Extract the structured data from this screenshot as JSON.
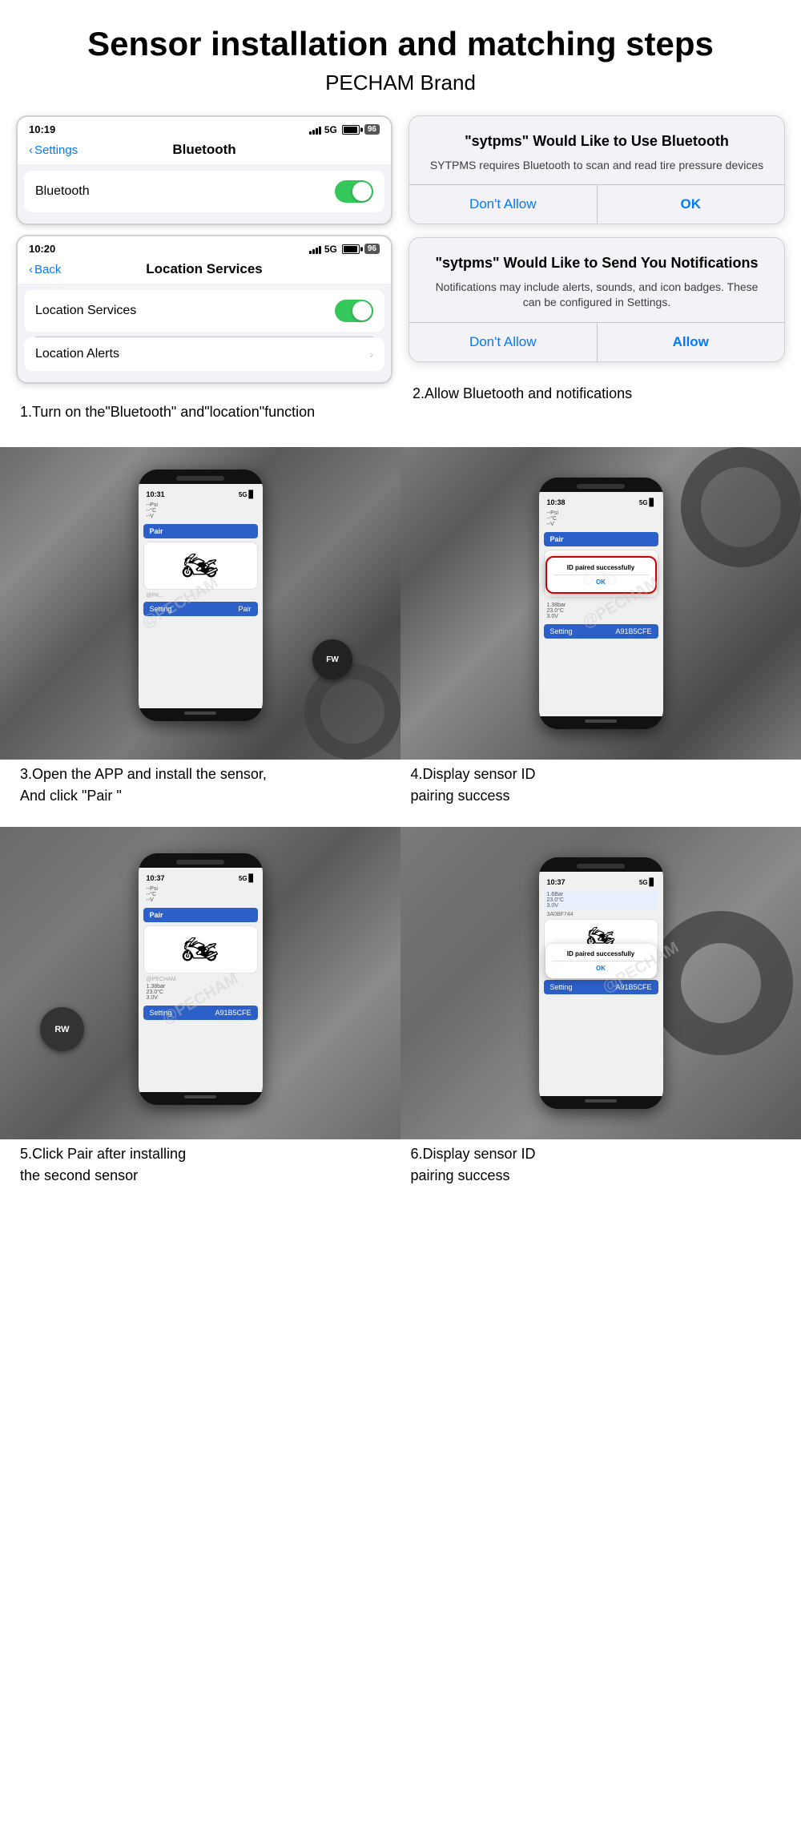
{
  "header": {
    "title": "Sensor installation and matching steps",
    "subtitle": "PECHAM Brand"
  },
  "section1": {
    "left": {
      "screen1": {
        "time": "10:19",
        "signal": "5G",
        "battery": "96",
        "back_label": "Settings",
        "nav_title": "Bluetooth",
        "toggle_label": "Bluetooth",
        "toggle_on": true
      },
      "screen2": {
        "time": "10:20",
        "signal": "5G",
        "battery": "96",
        "back_label": "Back",
        "nav_title": "Location Services",
        "row1_label": "Location Services",
        "row1_toggle": true,
        "row2_label": "Location Alerts",
        "row2_arrow": true
      },
      "caption": "1.Turn on the\"Bluetooth\" and\"location\"function"
    },
    "right": {
      "dialog1": {
        "title": "\"sytpms\" Would Like to Use Bluetooth",
        "message": "SYTPMS requires Bluetooth to scan and read tire pressure devices",
        "btn_cancel": "Don't Allow",
        "btn_ok": "OK"
      },
      "dialog2": {
        "title": "\"sytpms\" Would Like to Send You Notifications",
        "message": "Notifications may include alerts, sounds, and icon badges. These can be configured in Settings.",
        "btn_cancel": "Don't Allow",
        "btn_ok": "Allow"
      },
      "caption": "2.Allow Bluetooth and notifications"
    }
  },
  "section2": {
    "left_caption_line1": "3.Open the APP and install the sensor,",
    "left_caption_line2": "And click \"Pair \"",
    "right_caption_line1": "4.Display sensor ID",
    "right_caption_line2": "pairing success",
    "left_time": "10:31",
    "right_time": "10:38",
    "watermark": "@PECHAM",
    "success_text": "ID paired successfully",
    "ok_label": "OK"
  },
  "section3": {
    "left_caption_line1": "5.Click Pair after installing",
    "left_caption_line2": "the second sensor",
    "right_caption_line1": "6.Display sensor ID",
    "right_caption_line2": "pairing success",
    "left_time": "10:37",
    "right_time": "10:37",
    "watermark": "@PECHAM",
    "success_text": "ID paired successfully",
    "ok_label": "OK",
    "sensor_label_rw": "RW",
    "sensor_label_fw": "FW"
  }
}
